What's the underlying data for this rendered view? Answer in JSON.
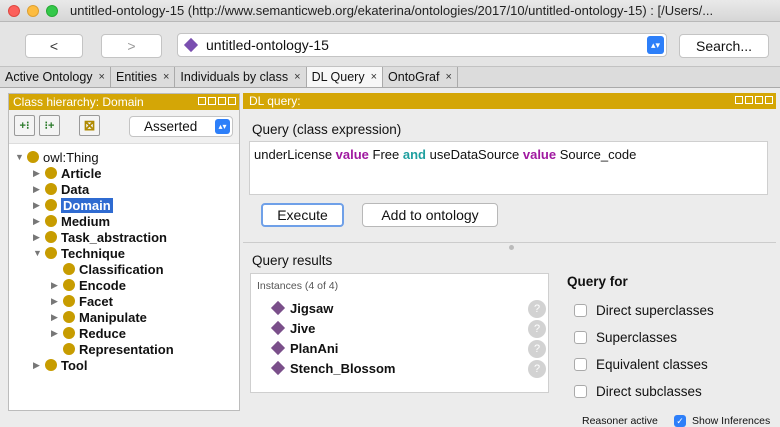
{
  "window": {
    "title": "untitled-ontology-15 (http://www.semanticweb.org/ekaterina/ontologies/2017/10/untitled-ontology-15)  : [/Users/..."
  },
  "nav": {
    "back_label": "<",
    "forward_label": ">",
    "address": "untitled-ontology-15",
    "search_label": "Search..."
  },
  "tabs": [
    {
      "label": "Active Ontology"
    },
    {
      "label": "Entities"
    },
    {
      "label": "Individuals by class"
    },
    {
      "label": "DL Query"
    },
    {
      "label": "OntoGraf"
    }
  ],
  "hierarchy": {
    "title": "Class hierarchy: Domain",
    "mode": "Asserted",
    "nodes": [
      {
        "label": "owl:Thing"
      },
      {
        "label": "Article"
      },
      {
        "label": "Data"
      },
      {
        "label": "Domain"
      },
      {
        "label": "Medium"
      },
      {
        "label": "Task_abstraction"
      },
      {
        "label": "Technique"
      },
      {
        "label": "Classification"
      },
      {
        "label": "Encode"
      },
      {
        "label": "Facet"
      },
      {
        "label": "Manipulate"
      },
      {
        "label": "Reduce"
      },
      {
        "label": "Representation"
      },
      {
        "label": "Tool"
      }
    ]
  },
  "query": {
    "panel_title": "DL query:",
    "label": "Query (class expression)",
    "tokens": [
      "underLicense ",
      "value",
      " Free ",
      "and",
      " useDataSource ",
      "value",
      " Source_code"
    ],
    "execute_label": "Execute",
    "add_label": "Add to ontology"
  },
  "results": {
    "label": "Query results",
    "instances_header": "Instances (4 of 4)",
    "items": [
      "Jigsaw",
      "Jive",
      "PlanAni",
      "Stench_Blossom"
    ]
  },
  "query_for": {
    "label": "Query for",
    "options": [
      "Direct superclasses",
      "Superclasses",
      "Equivalent classes",
      "Direct subclasses"
    ]
  },
  "footer": {
    "reasoner": "Reasoner active",
    "show_inferences": "Show Inferences"
  }
}
